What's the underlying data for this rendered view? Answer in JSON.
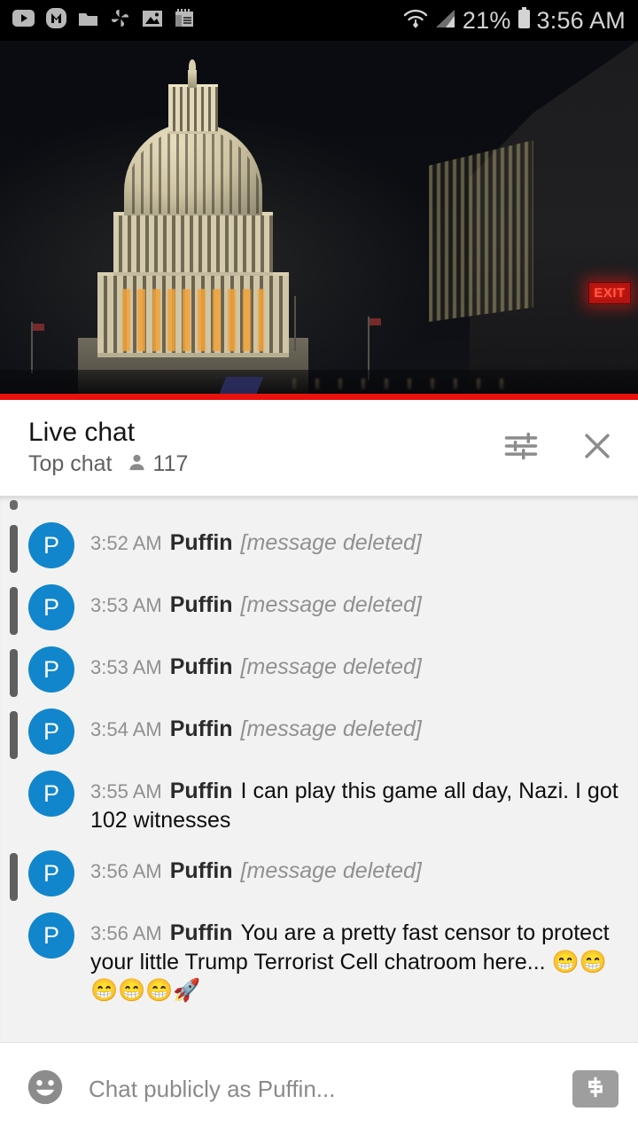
{
  "status_bar": {
    "left_icons": [
      {
        "name": "youtube-icon"
      },
      {
        "name": "m-app-icon"
      },
      {
        "name": "folder-icon"
      },
      {
        "name": "pinwheel-icon"
      },
      {
        "name": "gallery-image-icon"
      },
      {
        "name": "notepad-icon"
      }
    ],
    "right_icons": [
      {
        "name": "wifi-icon"
      },
      {
        "name": "cell-signal-icon"
      },
      {
        "name": "battery-icon"
      }
    ],
    "battery_percent": "21%",
    "time": "3:56 AM"
  },
  "video": {
    "exit_sign_label": "EXIT",
    "progress_color": "#e8110c"
  },
  "chat_header": {
    "title": "Live chat",
    "mode": "Top chat",
    "viewers": "117",
    "settings_icon": "tune-sliders-icon",
    "close_icon": "close-icon"
  },
  "messages": [
    {
      "time": "3:52 AM",
      "author": "Puffin",
      "avatar_letter": "P",
      "deleted": true,
      "text": "[message deleted]"
    },
    {
      "time": "3:53 AM",
      "author": "Puffin",
      "avatar_letter": "P",
      "deleted": true,
      "text": "[message deleted]"
    },
    {
      "time": "3:53 AM",
      "author": "Puffin",
      "avatar_letter": "P",
      "deleted": true,
      "text": "[message deleted]"
    },
    {
      "time": "3:54 AM",
      "author": "Puffin",
      "avatar_letter": "P",
      "deleted": true,
      "text": "[message deleted]"
    },
    {
      "time": "3:55 AM",
      "author": "Puffin",
      "avatar_letter": "P",
      "deleted": false,
      "text": "I can play this game all day, Nazi. I got 102 witnesses"
    },
    {
      "time": "3:56 AM",
      "author": "Puffin",
      "avatar_letter": "P",
      "deleted": true,
      "text": "[message deleted]"
    },
    {
      "time": "3:56 AM",
      "author": "Puffin",
      "avatar_letter": "P",
      "deleted": false,
      "text": "You are a pretty fast censor to protect your little Trump Terrorist Cell chatroom here... 😁😁😁😁😁🚀"
    }
  ],
  "input_bar": {
    "emoji_icon": "emoji-smiley-icon",
    "placeholder": "Chat publicly as Puffin...",
    "superchat_icon": "dollar-superchat-icon"
  },
  "colors": {
    "avatar_blue": "#1186cc",
    "live_red": "#e8110c",
    "chat_bg": "#f2f2f2"
  }
}
